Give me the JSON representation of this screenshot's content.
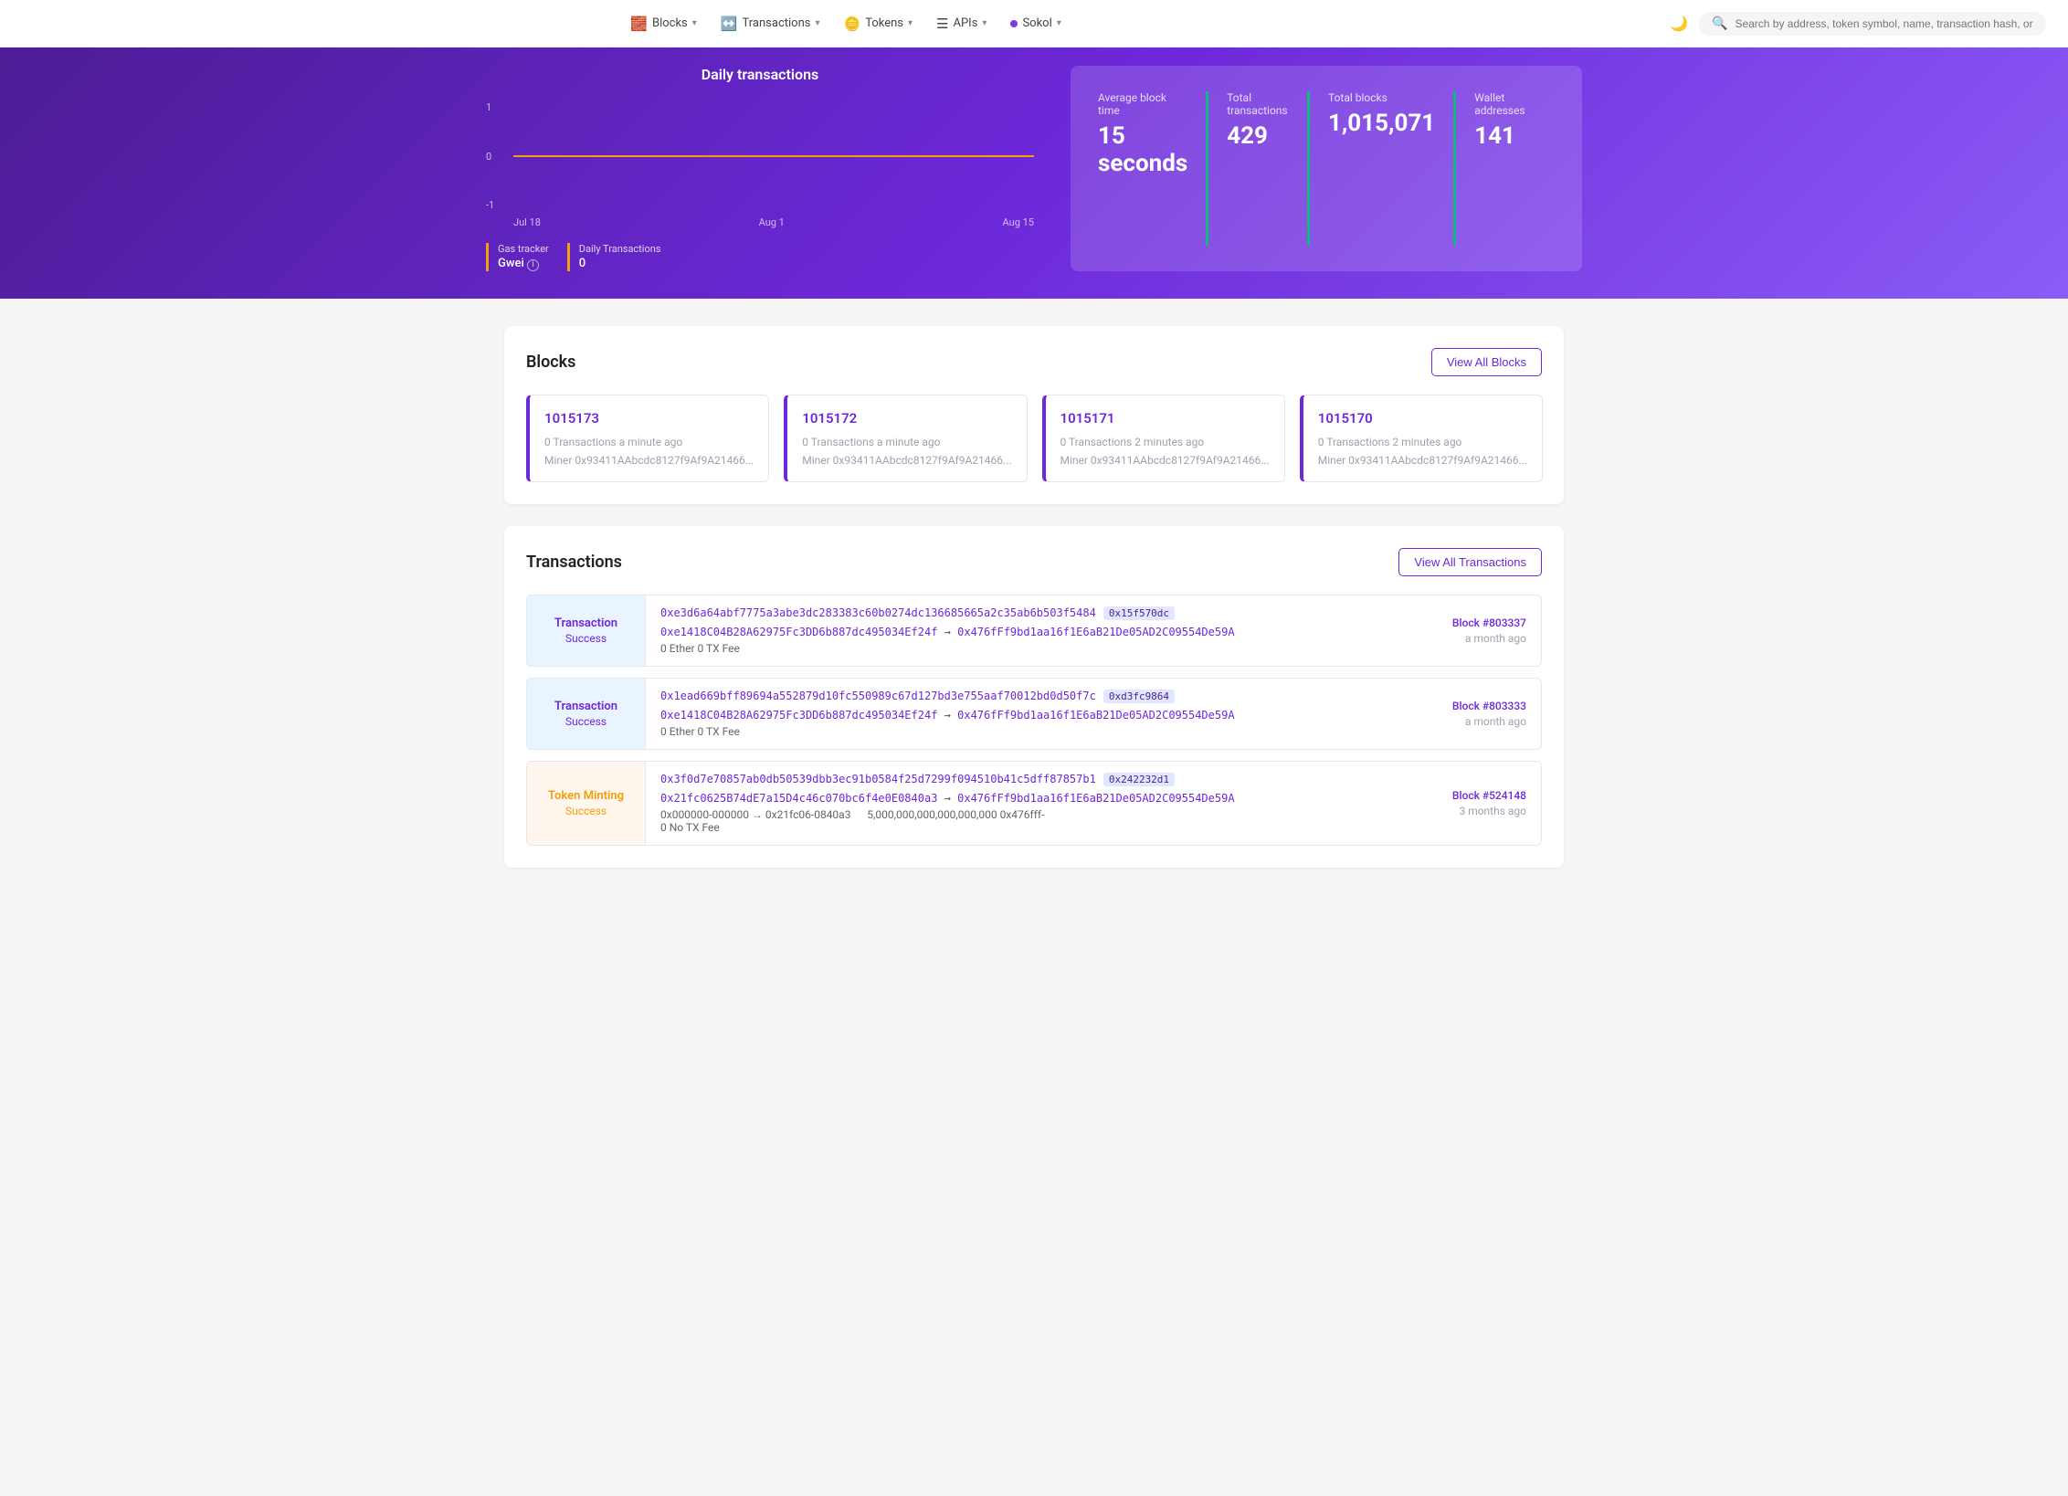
{
  "nav": {
    "blocks_label": "Blocks",
    "transactions_label": "Transactions",
    "tokens_label": "Tokens",
    "apis_label": "APIs",
    "network_label": "Sokol",
    "search_placeholder": "Search by address, token symbol, name, transaction hash, or block number"
  },
  "hero": {
    "chart_title": "Daily transactions",
    "chart_labels": [
      "1",
      "0",
      "-1"
    ],
    "chart_dates": [
      "Jul 18",
      "Aug 1",
      "Aug 15"
    ],
    "gas_tracker_label": "Gas tracker",
    "gas_value": "Gwei",
    "daily_tx_label": "Daily Transactions",
    "daily_tx_value": "0",
    "stats": [
      {
        "label": "Average block time",
        "value": "15 seconds"
      },
      {
        "label": "Total transactions",
        "value": "429"
      },
      {
        "label": "Total blocks",
        "value": "1,015,071"
      },
      {
        "label": "Wallet addresses",
        "value": "141"
      }
    ]
  },
  "blocks_section": {
    "title": "Blocks",
    "view_all_label": "View All Blocks",
    "blocks": [
      {
        "number": "1015173",
        "meta": "0 Transactions   a minute ago",
        "miner": "Miner 0x93411AAbcdc8127f9Af9A21466..."
      },
      {
        "number": "1015172",
        "meta": "0 Transactions   a minute ago",
        "miner": "Miner 0x93411AAbcdc8127f9Af9A21466..."
      },
      {
        "number": "1015171",
        "meta": "0 Transactions   2 minutes ago",
        "miner": "Miner 0x93411AAbcdc8127f9Af9A21466..."
      },
      {
        "number": "1015170",
        "meta": "0 Transactions   2 minutes ago",
        "miner": "Miner 0x93411AAbcdc8127f9Af9A21466..."
      }
    ]
  },
  "transactions_section": {
    "title": "Transactions",
    "view_all_label": "View All Transactions",
    "transactions": [
      {
        "type": "Transaction",
        "status": "Success",
        "badge_type": "success",
        "hash_main": "0xe3d6a64abf7775a3abe3dc283383c60b0274dc136685665a2c35ab6b503f5484",
        "hash_short": "0x15f570dc",
        "transfer": "0xe1418C04B28A62975Fc3DD6b887dc495034Ef24f → 0x476fFf9bd1aa16f1E6aB21De05AD2C09554De59A",
        "value": "0 Ether  0 TX Fee",
        "block_num": "Block #803337",
        "time": "a month ago"
      },
      {
        "type": "Transaction",
        "status": "Success",
        "badge_type": "success",
        "hash_main": "0x1ead669bff89694a552879d10fc550989c67d127bd3e755aaf70012bd0d50f7c",
        "hash_short": "0xd3fc9864",
        "transfer": "0xe1418C04B28A62975Fc3DD6b887dc495034Ef24f → 0x476fFf9bd1aa16f1E6aB21De05AD2C09554De59A",
        "value": "0 Ether  0 TX Fee",
        "block_num": "Block #803333",
        "time": "a month ago"
      },
      {
        "type": "Token Minting",
        "status": "Success",
        "badge_type": "token",
        "hash_main": "0x3f0d7e70857ab0db50539dbb3ec91b0584f25d7299f094510b41c5dff87857b1",
        "hash_short": "0x242232d1",
        "transfer": "0x21fc0625B74dE7a15D4c46c070bc6f4e0E0840a3 → 0x476fFf9bd1aa16f1E6aB21De05AD2C09554De59A",
        "extra_line1": "0x000000-000000 → 0x21fc06-0840a3",
        "extra_line2": "5,000,000,000,000,000,000  0x476fff-",
        "value": "0 No TX Fee",
        "block_num": "Block #524148",
        "time": "3 months ago"
      }
    ]
  }
}
